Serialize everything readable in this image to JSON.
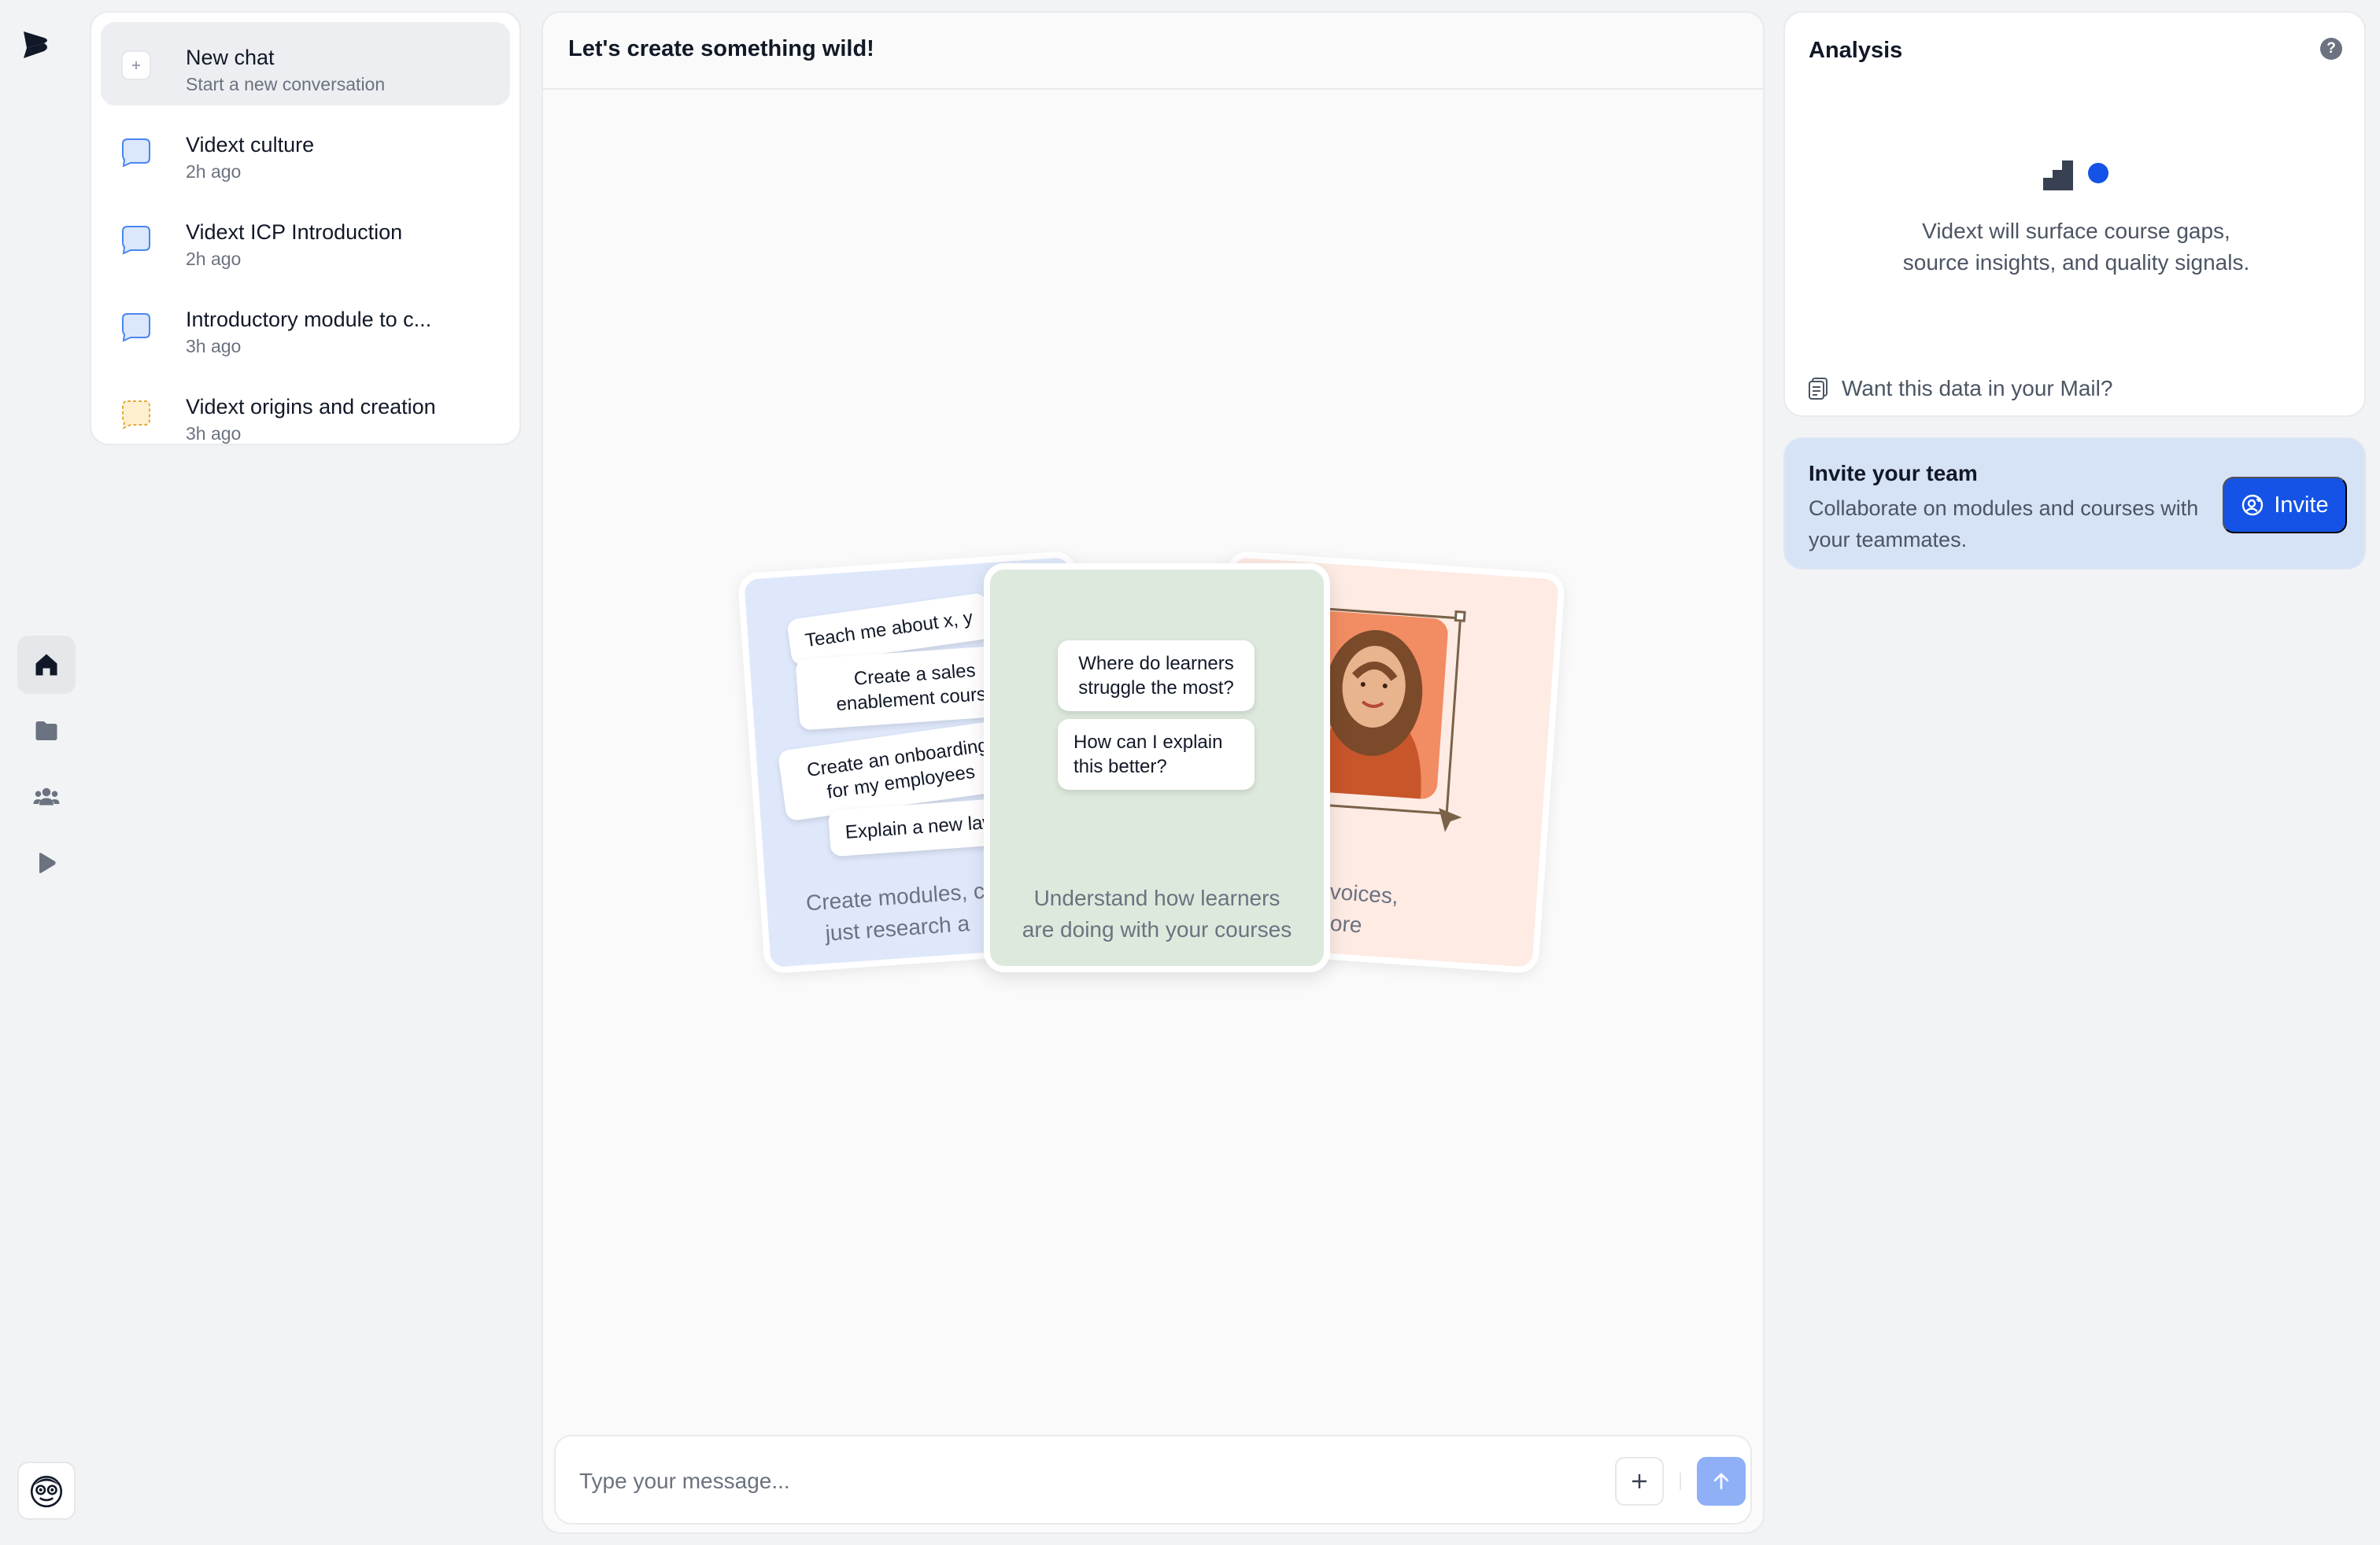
{
  "rail": {
    "logo_icon": "play-brand-logo",
    "items": [
      {
        "icon": "home-icon",
        "active": true
      },
      {
        "icon": "folder-icon",
        "active": false
      },
      {
        "icon": "users-icon",
        "active": false
      },
      {
        "icon": "play-icon",
        "active": false
      }
    ],
    "avatar_icon": "monkey-avatar"
  },
  "conversations": {
    "items": [
      {
        "title": "New chat",
        "subtitle": "Start a new conversation",
        "icon": "plus-icon",
        "selected": true
      },
      {
        "title": "Vidext culture",
        "subtitle": "2h ago",
        "icon": "chat-bubble-icon"
      },
      {
        "title": "Vidext ICP Introduction",
        "subtitle": "2h ago",
        "icon": "chat-bubble-icon"
      },
      {
        "title": "Introductory module to c...",
        "subtitle": "3h ago",
        "icon": "chat-bubble-icon"
      },
      {
        "title": "Vidext origins and creation",
        "subtitle": "3h ago",
        "icon": "chat-bubble-dashed-icon"
      }
    ]
  },
  "main": {
    "title": "Let's create something wild!",
    "cards": {
      "left": {
        "bubbles": [
          "Teach me about x, y",
          "Create a sales enablement course",
          "Create an onboarding for my employees",
          "Explain a new law"
        ],
        "caption_line1": "Create modules, c",
        "caption_line2": "just research a"
      },
      "center": {
        "bubbles": [
          "Where do learners struggle the most?",
          "How can I explain this better?"
        ],
        "caption_line1": "Understand how learners",
        "caption_line2": "are doing with your courses"
      },
      "right": {
        "caption_line1": "your own voices,",
        "caption_line2": "ars and more"
      }
    },
    "composer": {
      "placeholder": "Type your message...",
      "add_icon": "plus-icon",
      "send_icon": "arrow-up-icon"
    }
  },
  "analysis": {
    "title": "Analysis",
    "help_label": "?",
    "text": "Vidext will surface course gaps, source insights, and quality signals.",
    "text_line1": "Vidext will surface course gaps,",
    "text_line2": "source insights, and quality signals.",
    "mail_label": "Want this data in your Mail?"
  },
  "invite": {
    "title": "Invite your team",
    "description": "Collaborate on modules and courses with your teammates.",
    "button_label": "Invite"
  },
  "colors": {
    "accent": "#1453e6",
    "send_disabled": "#8fb0f7",
    "background": "#f2f3f5"
  }
}
